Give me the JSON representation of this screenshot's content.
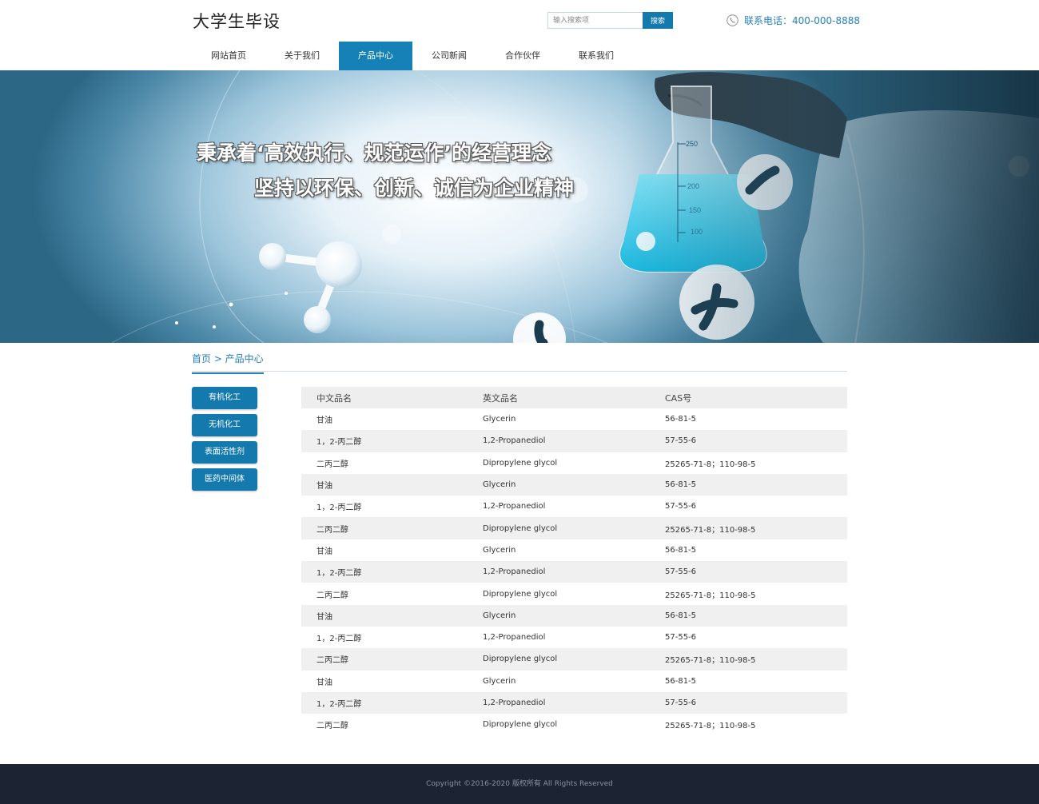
{
  "header": {
    "site_title": "大学生毕设",
    "search_placeholder": "输入搜索项",
    "search_button": "搜索",
    "phone": "联系电话：400-000-8888"
  },
  "nav": [
    {
      "label": "网站首页"
    },
    {
      "label": "关于我们"
    },
    {
      "label": "产品中心"
    },
    {
      "label": "公司新闻"
    },
    {
      "label": "合作伙伴"
    },
    {
      "label": "联系我们"
    }
  ],
  "banner": {
    "line1": "秉承着‘高效执行、规范运作’的经营理念",
    "line2": "坚持以环保、创新、诚信为企业精神",
    "flask_marks": [
      "250",
      "200",
      "150",
      "100"
    ]
  },
  "breadcrumb": "首页 > 产品中心",
  "sidebar": [
    {
      "label": "有机化工"
    },
    {
      "label": "无机化工"
    },
    {
      "label": "表面活性剂"
    },
    {
      "label": "医药中间体"
    }
  ],
  "table": {
    "headers": [
      "中文品名",
      "英文品名",
      "CAS号"
    ],
    "rows": [
      [
        "甘油",
        "Glycerin",
        "56-81-5"
      ],
      [
        "1，2-丙二醇",
        "1,2-Propanediol",
        "57-55-6"
      ],
      [
        "二丙二醇",
        "Dipropylene glycol",
        "25265-71-8；110-98-5"
      ],
      [
        "甘油",
        "Glycerin",
        "56-81-5"
      ],
      [
        "1，2-丙二醇",
        "1,2-Propanediol",
        "57-55-6"
      ],
      [
        "二丙二醇",
        "Dipropylene glycol",
        "25265-71-8；110-98-5"
      ],
      [
        "甘油",
        "Glycerin",
        "56-81-5"
      ],
      [
        "1，2-丙二醇",
        "1,2-Propanediol",
        "57-55-6"
      ],
      [
        "二丙二醇",
        "Dipropylene glycol",
        "25265-71-8；110-98-5"
      ],
      [
        "甘油",
        "Glycerin",
        "56-81-5"
      ],
      [
        "1，2-丙二醇",
        "1,2-Propanediol",
        "57-55-6"
      ],
      [
        "二丙二醇",
        "Dipropylene glycol",
        "25265-71-8；110-98-5"
      ],
      [
        "甘油",
        "Glycerin",
        "56-81-5"
      ],
      [
        "1，2-丙二醇",
        "1,2-Propanediol",
        "57-55-6"
      ],
      [
        "二丙二醇",
        "Dipropylene glycol",
        "25265-71-8；110-98-5"
      ]
    ]
  },
  "footer": "Copyright ©2016-2020 版权所有 All Rights Reserved",
  "colors": {
    "accent": "#1479ad",
    "footer_bg": "#1c2332",
    "link": "#2580b8"
  }
}
